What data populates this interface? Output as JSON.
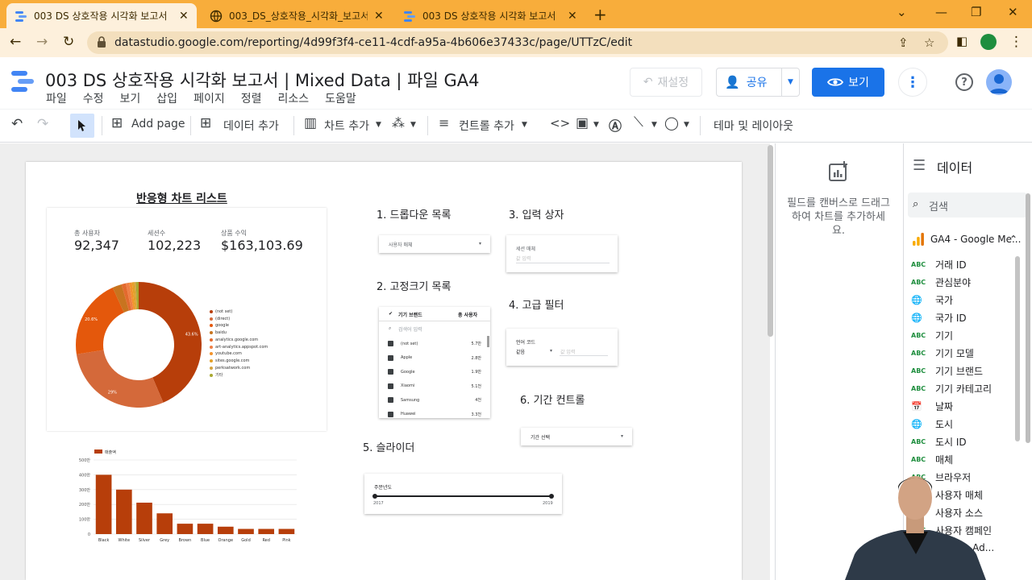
{
  "browser": {
    "tabs": [
      {
        "label": "003 DS 상호작용 시각화 보고서",
        "active": true
      },
      {
        "label": "003_DS_상호작용_시각화_보고서",
        "active": false
      },
      {
        "label": "003 DS 상호작용 시각화 보고서",
        "active": false
      }
    ],
    "url": "datastudio.google.com/reporting/4d99f3f4-ce11-4cdf-a95a-4b606e37433c/page/UTTzC/edit"
  },
  "app": {
    "title": "003 DS 상호작용 시각화 보고서 | Mixed Data | 파일 GA4",
    "menus": [
      "파일",
      "수정",
      "보기",
      "삽입",
      "페이지",
      "정렬",
      "리소스",
      "도움말"
    ],
    "reset_label": "재설정",
    "share_label": "공유",
    "view_label": "보기",
    "accent": "#1a73e8"
  },
  "toolbar": {
    "add_page": "Add page",
    "add_data": "데이터 추가",
    "add_chart": "차트 추가",
    "add_control": "컨트롤 추가",
    "theme": "테마 및 레이아웃"
  },
  "report": {
    "page_title": "반응형 차트 리스트",
    "scorecards": [
      {
        "label": "총 사용자",
        "value": "92,347"
      },
      {
        "label": "세션수",
        "value": "102,223"
      },
      {
        "label": "상품 수익",
        "value": "$163,103.69"
      }
    ],
    "sections": {
      "dropdown": "1. 드롭다운 목록",
      "fixed_list": "2. 고정크기 목록",
      "input_box": "3. 입력 상자",
      "advanced_filter": "4. 고급 필터",
      "slider": "5. 슬라이더",
      "date_control": "6. 기간 컨트롤"
    },
    "dropdown_label": "사용자 매체",
    "input_box": {
      "label": "세션 매체",
      "placeholder": "값 입력"
    },
    "advanced_filter": {
      "label": "언어 코드",
      "operator": "같음",
      "placeholder": "값 입력"
    },
    "fixed_list": {
      "header_dim": "기기 브랜드",
      "header_metric": "총 사용자",
      "search_placeholder": "검색어 입력",
      "rows": [
        {
          "name": "(not set)",
          "value": "5.7만"
        },
        {
          "name": "Apple",
          "value": "2.8만"
        },
        {
          "name": "Google",
          "value": "1.9만"
        },
        {
          "name": "Xiaomi",
          "value": "5.1천"
        },
        {
          "name": "Samsung",
          "value": "4천"
        },
        {
          "name": "Huawei",
          "value": "3.3천"
        }
      ]
    },
    "slider": {
      "label": "주문년도",
      "min_label": "2017",
      "max_label": "2019"
    },
    "date_control_label": "기간 선택"
  },
  "chart_data": [
    {
      "type": "pie",
      "title": "",
      "legend_position": "right",
      "labels": [
        "(not set)",
        "(direct)",
        "google",
        "baidu",
        "analytics.google.com",
        "art-analytics.appspot.com",
        "youtube.com",
        "sites.google.com",
        "perksatwork.com",
        "기타"
      ],
      "values": [
        43.6,
        29,
        20.6,
        2.4,
        1.1,
        0.9,
        0.7,
        0.6,
        0.4,
        0.7
      ],
      "data_labels": {
        "(not set)": "43.6%",
        "(direct)": "29%",
        "google": "20.6%"
      },
      "colors": [
        "#b73e0a",
        "#d4693a",
        "#e4580c",
        "#c8741f",
        "#e36a2e",
        "#ef7f45",
        "#f2932c",
        "#e3a027",
        "#d4a23e",
        "#a8a830"
      ]
    },
    {
      "type": "bar",
      "title": "",
      "legend": [
        "매출액"
      ],
      "categories": [
        "Black",
        "White",
        "Silver",
        "Grey",
        "Brown",
        "Blue",
        "Orange",
        "Gold",
        "Red",
        "Pink"
      ],
      "values": [
        400,
        300,
        212,
        140,
        70,
        70,
        50,
        35,
        35,
        35
      ],
      "ylim": [
        0,
        500
      ],
      "yticks": [
        "0",
        "100만",
        "200만",
        "300만",
        "400만",
        "500만"
      ],
      "color": "#b73e0a",
      "grid": true
    }
  ],
  "panel": {
    "hint": "필드를 캔버스로 드래그하여 차트를 추가하세요.",
    "title": "데이터",
    "search_placeholder": "검색",
    "source": "GA4 - Google Me...",
    "fields": [
      {
        "type": "ABC",
        "name": "거래 ID"
      },
      {
        "type": "ABC",
        "name": "관심분야"
      },
      {
        "type": "GEO",
        "name": "국가"
      },
      {
        "type": "GEO",
        "name": "국가 ID"
      },
      {
        "type": "ABC",
        "name": "기기"
      },
      {
        "type": "ABC",
        "name": "기기 모델"
      },
      {
        "type": "ABC",
        "name": "기기 브랜드"
      },
      {
        "type": "ABC",
        "name": "기기 카테고리"
      },
      {
        "type": "DATE",
        "name": "날짜"
      },
      {
        "type": "GEO",
        "name": "도시"
      },
      {
        "type": "ABC",
        "name": "도시 ID"
      },
      {
        "type": "ABC",
        "name": "매체"
      },
      {
        "type": "ABC",
        "name": "브라우저"
      },
      {
        "type": "ABC",
        "name": "사용자 매체"
      },
      {
        "type": "ABC",
        "name": "사용자 소스"
      },
      {
        "type": "ABC",
        "name": "사용자 캠페인"
      },
      {
        "type": "ABC",
        "name": "Google Ad..."
      }
    ]
  }
}
